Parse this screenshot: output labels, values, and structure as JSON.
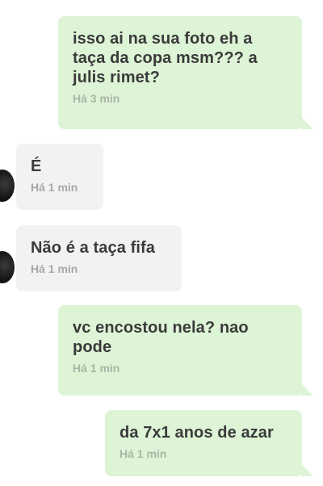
{
  "chat": {
    "messages": [
      {
        "direction": "sent",
        "text": " isso ai na sua foto eh a taça da copa msm??? a julis rimet?",
        "time": "Há 3 min"
      },
      {
        "direction": "received",
        "text": "É",
        "time": "Há 1 min"
      },
      {
        "direction": "received",
        "text": "Não é a taça fifa",
        "time": "Há 1 min"
      },
      {
        "direction": "sent",
        "text": "vc encostou nela? nao pode",
        "time": "Há 1 min"
      },
      {
        "direction": "sent",
        "text": "da 7x1 anos de azar",
        "time": "Há 1 min"
      }
    ]
  }
}
